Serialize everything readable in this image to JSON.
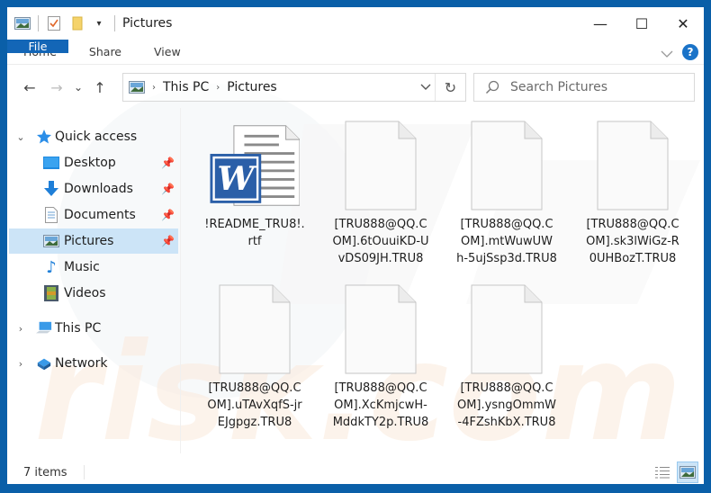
{
  "window": {
    "title": "Pictures",
    "controls": {
      "minimize": "—",
      "maximize": "☐",
      "close": "✕"
    }
  },
  "ribbon": {
    "tabs": [
      {
        "label": "File",
        "active": true
      },
      {
        "label": "Home"
      },
      {
        "label": "Share"
      },
      {
        "label": "View"
      }
    ],
    "help_label": "?"
  },
  "navigation": {
    "back": "←",
    "forward": "→",
    "recent": "⌄",
    "up": "↑",
    "breadcrumb": [
      "This PC",
      "Pictures"
    ],
    "breadcrumb_sep": "›",
    "refresh": "↻",
    "search_placeholder": "Search Pictures"
  },
  "sidebar": {
    "quick_access": {
      "label": "Quick access",
      "expanded": true,
      "items": [
        {
          "label": "Desktop",
          "icon": "desktop-icon",
          "pinned": true
        },
        {
          "label": "Downloads",
          "icon": "downloads-icon",
          "pinned": true
        },
        {
          "label": "Documents",
          "icon": "documents-icon",
          "pinned": true
        },
        {
          "label": "Pictures",
          "icon": "pictures-icon",
          "pinned": true,
          "selected": true
        },
        {
          "label": "Music",
          "icon": "music-icon",
          "pinned": false
        },
        {
          "label": "Videos",
          "icon": "videos-icon",
          "pinned": false
        }
      ]
    },
    "this_pc": {
      "label": "This PC"
    },
    "network": {
      "label": "Network"
    }
  },
  "files": [
    {
      "name": "!README_TRU8!.\nrtf",
      "type": "word-doc"
    },
    {
      "name": "[TRU888@QQ.C\nOM].6tOuuiKD-U\nvDS09JH.TRU8",
      "type": "blank"
    },
    {
      "name": "[TRU888@QQ.C\nOM].mtWuwUW\nh-5ujSsp3d.TRU8",
      "type": "blank"
    },
    {
      "name": "[TRU888@QQ.C\nOM].sk3lWiGz-R\n0UHBozT.TRU8",
      "type": "blank"
    },
    {
      "name": "[TRU888@QQ.C\nOM].uTAvXqfS-jr\nEJgpgz.TRU8",
      "type": "blank"
    },
    {
      "name": "[TRU888@QQ.C\nOM].XcKmjcwH-\nMddkTY2p.TRU8",
      "type": "blank"
    },
    {
      "name": "[TRU888@QQ.C\nOM].ysngOmmW\n-4FZshKbX.TRU8",
      "type": "blank"
    }
  ],
  "status": {
    "item_count": "7 items"
  },
  "colors": {
    "accent": "#1366b7",
    "frame": "#0a5fa8",
    "selection": "#cce4f7"
  }
}
